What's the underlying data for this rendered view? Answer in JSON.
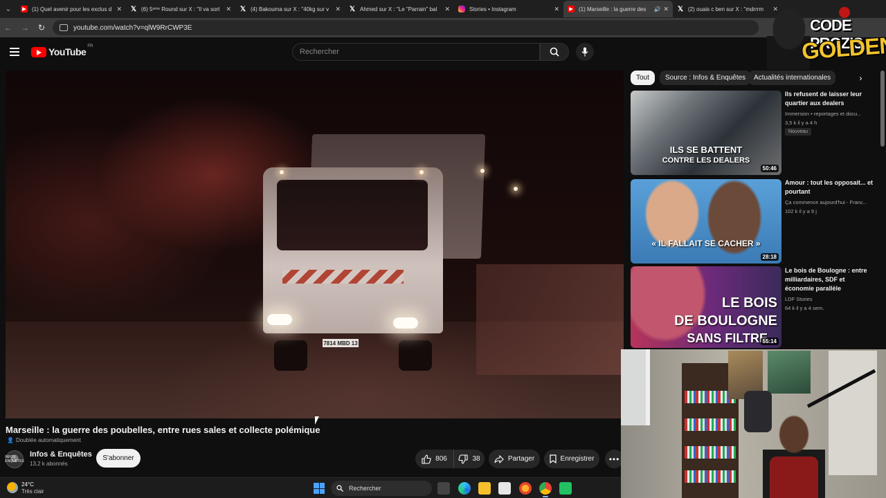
{
  "browser": {
    "tabs": [
      {
        "title": "(1) Quel avenir pour les exclus d",
        "favicon": "youtube-icon",
        "active": false,
        "audio": false
      },
      {
        "title": "(6) 5ᵉᵐᵉ Round sur X : \"Il va sort",
        "favicon": "x-icon",
        "active": false,
        "audio": false
      },
      {
        "title": "(4) Bakouma sur X : \"40kg sur v",
        "favicon": "x-icon",
        "active": false,
        "audio": false
      },
      {
        "title": "Ahmed sur X : \"Le \"Parrain\" bal",
        "favicon": "x-icon",
        "active": false,
        "audio": false
      },
      {
        "title": "Stories • Instagram",
        "favicon": "instagram-icon",
        "active": false,
        "audio": false
      },
      {
        "title": "(1) Marseille : la guerre des",
        "favicon": "youtube-icon",
        "active": true,
        "audio": true
      },
      {
        "title": "(2) ouais c ben sur X : \"mdrrrm",
        "favicon": "x-icon",
        "active": false,
        "audio": false
      }
    ],
    "url": "youtube.com/watch?v=qlW9RrCWP3E"
  },
  "youtube": {
    "logo_text": "YouTube",
    "country_code": "FR",
    "search_placeholder": "Rechercher"
  },
  "video": {
    "title": "Marseille : la guerre des poubelles, entre rues sales et collecte polémique",
    "dub_note": "Doublée automatiquement",
    "plate_text": "7814 MBD 13",
    "channel": {
      "name": "Infos & Enquêtes",
      "subscribers": "13,2 k abonnés",
      "avatar_text": "INFOS ENQUÊTES"
    },
    "subscribe_label": "S'abonner",
    "likes": "806",
    "dislikes": "38",
    "share_label": "Partager",
    "save_label": "Enregistrer",
    "more_label": "•••"
  },
  "chips": [
    {
      "label": "Tout",
      "active": true
    },
    {
      "label": "Source : Infos & Enquêtes",
      "active": false
    },
    {
      "label": "Actualités internationales",
      "active": false
    }
  ],
  "recommendations": [
    {
      "title": "Ils refusent de laisser leur quartier aux dealers",
      "channel": "Immersion • reportages et docu...",
      "stats": "3,5 k  il y a 4 h",
      "badge": "Nouveau",
      "duration": "50:46",
      "thumb_caption_1": "ILS SE BATTENT",
      "thumb_caption_2": "CONTRE LES DEALERS"
    },
    {
      "title": "Amour : tout les opposait... et pourtant",
      "channel": "Ça commence aujourd'hui - Franc...",
      "stats": "102 k  il y a 9 j",
      "badge": "",
      "duration": "28:18",
      "thumb_caption_1": "« IL FALLAIT SE CACHER »",
      "thumb_caption_2": ""
    },
    {
      "title": "Le bois de Boulogne : entre milliardaires, SDF et économie parallèle",
      "channel": "LDF Stories",
      "stats": "64 k  il y a 4 sem.",
      "badge": "",
      "duration": "55:14",
      "thumb_caption_1": "LE BOIS",
      "thumb_caption_2": "DE BOULOGNE",
      "thumb_caption_3": "SANS FILTRE"
    }
  ],
  "overlay_logo": {
    "line1": "CODE PROZIS",
    "line2": "GOLDENG"
  },
  "taskbar": {
    "temperature": "24°C",
    "weather": "Très clair",
    "search_label": "Rechercher"
  }
}
